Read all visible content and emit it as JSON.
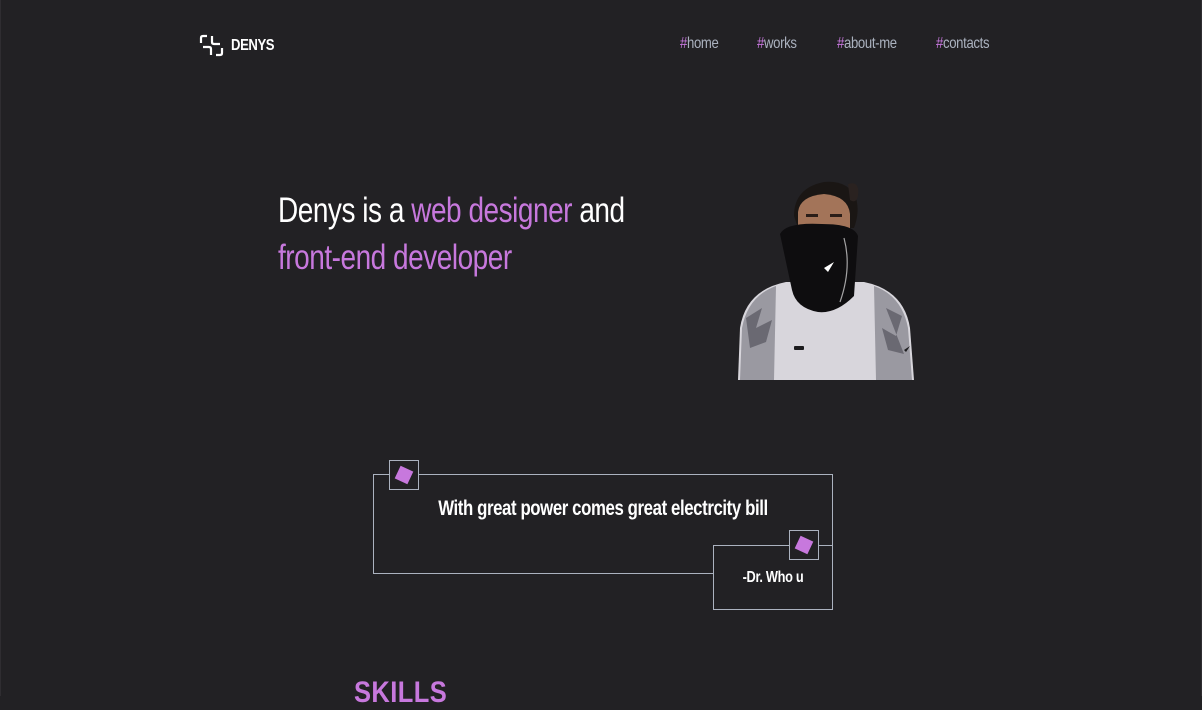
{
  "header": {
    "logo": {
      "icon": "logo-brackets-icon",
      "text": "DENYS"
    },
    "nav": [
      {
        "hash": "#",
        "label": "home"
      },
      {
        "hash": "#",
        "label": "works"
      },
      {
        "hash": "#",
        "label": "about-me"
      },
      {
        "hash": "#",
        "label": "contacts"
      }
    ]
  },
  "hero": {
    "title_part1": "Denys is a ",
    "title_accent1": "web designer",
    "title_part2": " and",
    "title_accent2": "front-end developer",
    "photo": "portrait-photo"
  },
  "quote": {
    "text": "With great power comes great electrcity bill",
    "author": "-Dr. Who u",
    "mark_icon": "quote-diamond-icon"
  },
  "skills": {
    "heading": "SKILLS"
  },
  "colors": {
    "background": "#222124",
    "accent": "#c778dd",
    "muted": "#abb2bf",
    "text": "#ffffff"
  }
}
